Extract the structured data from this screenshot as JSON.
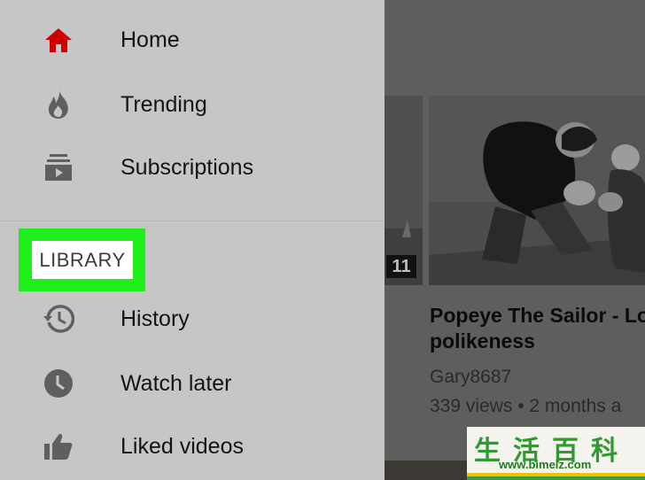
{
  "sidebar": {
    "items": [
      {
        "label": "Home",
        "icon": "home-icon",
        "color": "#cc0000"
      },
      {
        "label": "Trending",
        "icon": "trending-flame-icon"
      },
      {
        "label": "Subscriptions",
        "icon": "subscriptions-icon"
      }
    ],
    "library_header": "LIBRARY",
    "library_items": [
      {
        "label": "History",
        "icon": "history-icon"
      },
      {
        "label": "Watch later",
        "icon": "clock-icon"
      },
      {
        "label": "Liked videos",
        "icon": "thumbs-up-icon"
      }
    ],
    "highlight_color": "#1eee1a"
  },
  "main": {
    "partial_duration": "11",
    "video": {
      "title_line1": "Popeye The Sailor - Lo",
      "title_line2": "polikeness",
      "channel": "Gary8687",
      "meta": "339 views • 2 months a"
    }
  },
  "watermark": {
    "chars": "生活百科",
    "url": "www.bimeiz.com"
  }
}
